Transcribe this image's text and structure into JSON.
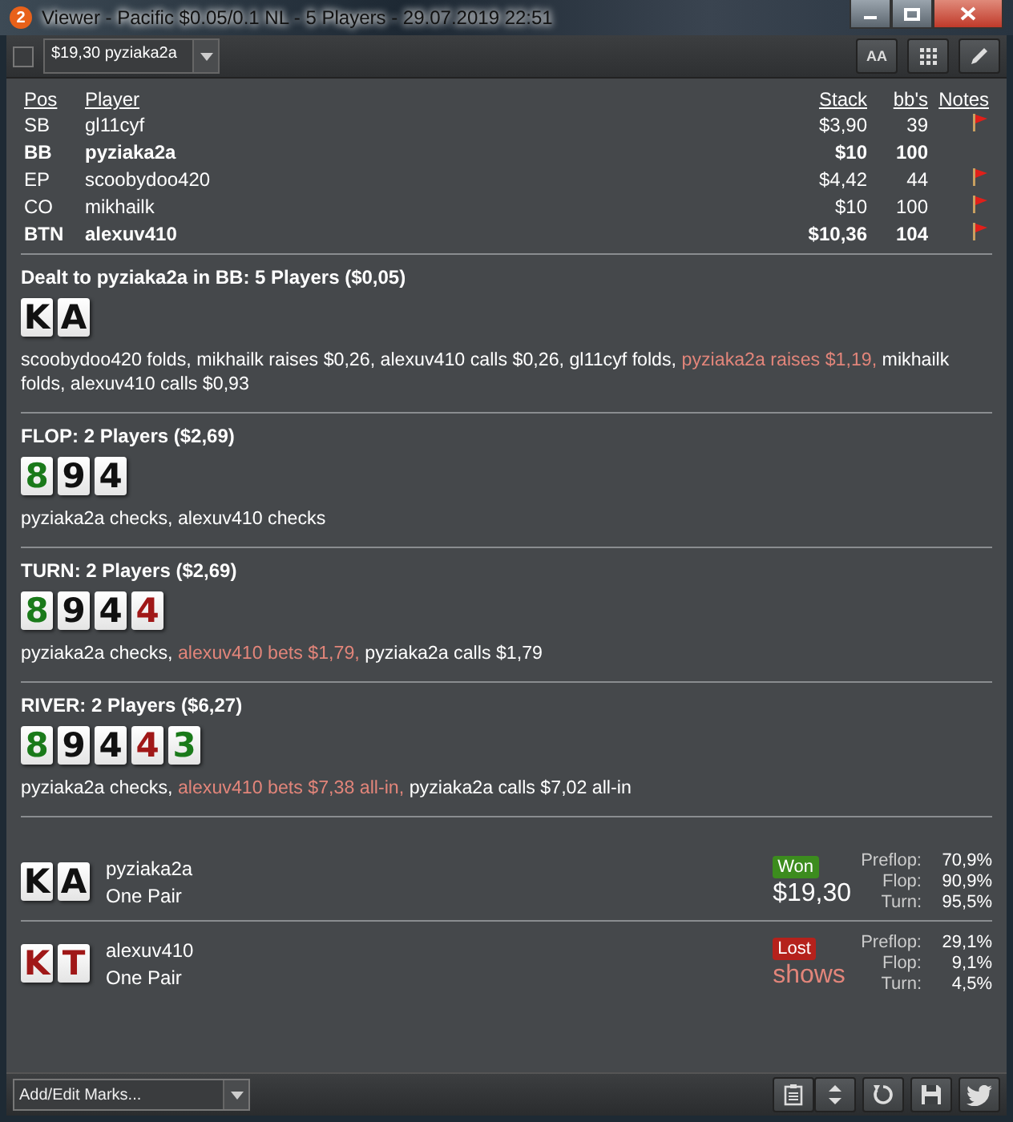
{
  "window": {
    "app_badge": "2",
    "title": "Viewer - Pacific $0.05/0.1 NL - 5 Players - 29.07.2019 22:51"
  },
  "toolbar": {
    "checked": false,
    "hand_select": "$19,30 pyziaka2a",
    "font_button": "AA"
  },
  "players": {
    "columns": [
      "Pos",
      "Player",
      "Stack",
      "bb's",
      "Notes"
    ],
    "rows": [
      {
        "pos": "SB",
        "player": "gl11cyf",
        "stack": "$3,90",
        "bbs": "39",
        "bold": false,
        "note": true
      },
      {
        "pos": "BB",
        "player": "pyziaka2a",
        "stack": "$10",
        "bbs": "100",
        "bold": true,
        "note": false
      },
      {
        "pos": "EP",
        "player": "scoobydoo420",
        "stack": "$4,42",
        "bbs": "44",
        "bold": false,
        "note": true
      },
      {
        "pos": "CO",
        "player": "mikhailk",
        "stack": "$10",
        "bbs": "100",
        "bold": false,
        "note": true
      },
      {
        "pos": "BTN",
        "player": "alexuv410",
        "stack": "$10,36",
        "bbs": "104",
        "bold": true,
        "note": true
      }
    ]
  },
  "streets": [
    {
      "title": "Dealt to pyziaka2a in BB: 5 Players ($0,05)",
      "cards": [
        {
          "rank": "K",
          "color": "#111111"
        },
        {
          "rank": "A",
          "color": "#111111"
        }
      ],
      "actions": [
        {
          "text": "scoobydoo420 folds, mikhailk raises $0,26, alexuv410 calls $0,26, gl11cyf folds, ",
          "highlight": false
        },
        {
          "text": "pyziaka2a raises $1,19,",
          "highlight": true
        },
        {
          "text": " mikhailk folds, alexuv410 calls $0,93",
          "highlight": false
        }
      ]
    },
    {
      "title": "FLOP: 2 Players ($2,69)",
      "cards": [
        {
          "rank": "8",
          "color": "#1a7a1a"
        },
        {
          "rank": "9",
          "color": "#111111"
        },
        {
          "rank": "4",
          "color": "#111111"
        }
      ],
      "actions": [
        {
          "text": "pyziaka2a checks, alexuv410 checks",
          "highlight": false
        }
      ]
    },
    {
      "title": "TURN: 2 Players ($2,69)",
      "cards": [
        {
          "rank": "8",
          "color": "#1a7a1a"
        },
        {
          "rank": "9",
          "color": "#111111"
        },
        {
          "rank": "4",
          "color": "#111111"
        },
        {
          "rank": "4",
          "color": "#a01818"
        }
      ],
      "actions": [
        {
          "text": "pyziaka2a checks, ",
          "highlight": false
        },
        {
          "text": "alexuv410 bets $1,79,",
          "highlight": true
        },
        {
          "text": " pyziaka2a calls $1,79",
          "highlight": false
        }
      ]
    },
    {
      "title": "RIVER: 2 Players ($6,27)",
      "cards": [
        {
          "rank": "8",
          "color": "#1a7a1a"
        },
        {
          "rank": "9",
          "color": "#111111"
        },
        {
          "rank": "4",
          "color": "#111111"
        },
        {
          "rank": "4",
          "color": "#a01818"
        },
        {
          "rank": "3",
          "color": "#1a7a1a"
        }
      ],
      "actions": [
        {
          "text": "pyziaka2a checks, ",
          "highlight": false
        },
        {
          "text": "alexuv410 bets $7,38 all-in,",
          "highlight": true
        },
        {
          "text": " pyziaka2a calls $7,02 all-in",
          "highlight": false
        }
      ]
    }
  ],
  "results": [
    {
      "cards": [
        {
          "rank": "K",
          "color": "#111111"
        },
        {
          "rank": "A",
          "color": "#111111"
        }
      ],
      "player": "pyziaka2a",
      "hand": "One Pair",
      "won": true,
      "badge": "Won",
      "amount": "$19,30",
      "equity": [
        {
          "label": "Preflop:",
          "value": "70,9%"
        },
        {
          "label": "Flop:",
          "value": "90,9%"
        },
        {
          "label": "Turn:",
          "value": "95,5%"
        }
      ]
    },
    {
      "cards": [
        {
          "rank": "K",
          "color": "#a01818"
        },
        {
          "rank": "T",
          "color": "#a01818"
        }
      ],
      "player": "alexuv410",
      "hand": "One Pair",
      "won": false,
      "badge": "Lost",
      "amount": "shows",
      "equity": [
        {
          "label": "Preflop:",
          "value": "29,1%"
        },
        {
          "label": "Flop:",
          "value": "9,1%"
        },
        {
          "label": "Turn:",
          "value": "4,5%"
        }
      ]
    }
  ],
  "footer": {
    "marks_placeholder": "Add/Edit Marks..."
  }
}
